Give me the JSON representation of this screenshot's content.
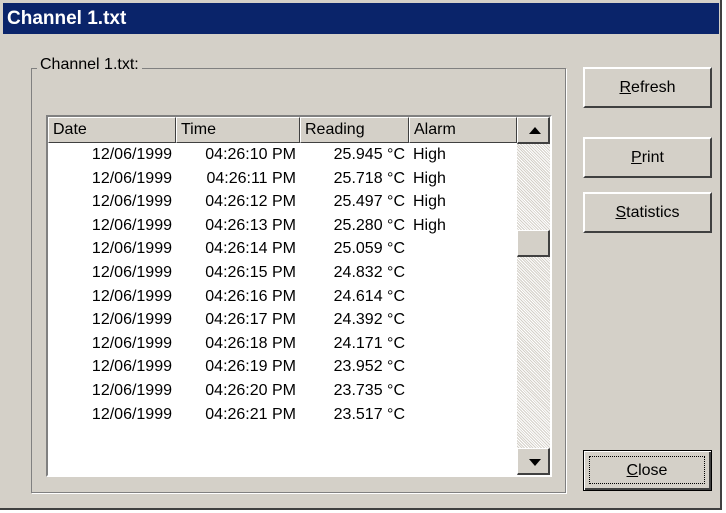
{
  "window": {
    "title": "Channel 1.txt"
  },
  "group": {
    "label": "Channel 1.txt:"
  },
  "table": {
    "columns": [
      "Date",
      "Time",
      "Reading",
      "Alarm"
    ],
    "rows": [
      [
        "12/06/1999",
        "04:26:10 PM",
        "25.945 °C",
        "High"
      ],
      [
        "12/06/1999",
        "04:26:11 PM",
        "25.718 °C",
        "High"
      ],
      [
        "12/06/1999",
        "04:26:12 PM",
        "25.497 °C",
        "High"
      ],
      [
        "12/06/1999",
        "04:26:13 PM",
        "25.280 °C",
        "High"
      ],
      [
        "12/06/1999",
        "04:26:14 PM",
        "25.059 °C",
        ""
      ],
      [
        "12/06/1999",
        "04:26:15 PM",
        "24.832 °C",
        ""
      ],
      [
        "12/06/1999",
        "04:26:16 PM",
        "24.614 °C",
        ""
      ],
      [
        "12/06/1999",
        "04:26:17 PM",
        "24.392 °C",
        ""
      ],
      [
        "12/06/1999",
        "04:26:18 PM",
        "24.171 °C",
        ""
      ],
      [
        "12/06/1999",
        "04:26:19 PM",
        "23.952 °C",
        ""
      ],
      [
        "12/06/1999",
        "04:26:20 PM",
        "23.735 °C",
        ""
      ],
      [
        "12/06/1999",
        "04:26:21 PM",
        "23.517 °C",
        ""
      ]
    ]
  },
  "buttons": {
    "refresh": {
      "mnemonic": "R",
      "rest": "efresh"
    },
    "print": {
      "mnemonic": "P",
      "rest": "rint"
    },
    "statistics": {
      "mnemonic": "S",
      "rest": "tatistics"
    },
    "close": {
      "mnemonic": "C",
      "rest": "lose"
    }
  },
  "icons": {
    "scroll_up": "arrow-up-icon",
    "scroll_down": "arrow-down-icon"
  },
  "colors": {
    "titlebar": "#0a246a",
    "face": "#d4d0c8"
  }
}
